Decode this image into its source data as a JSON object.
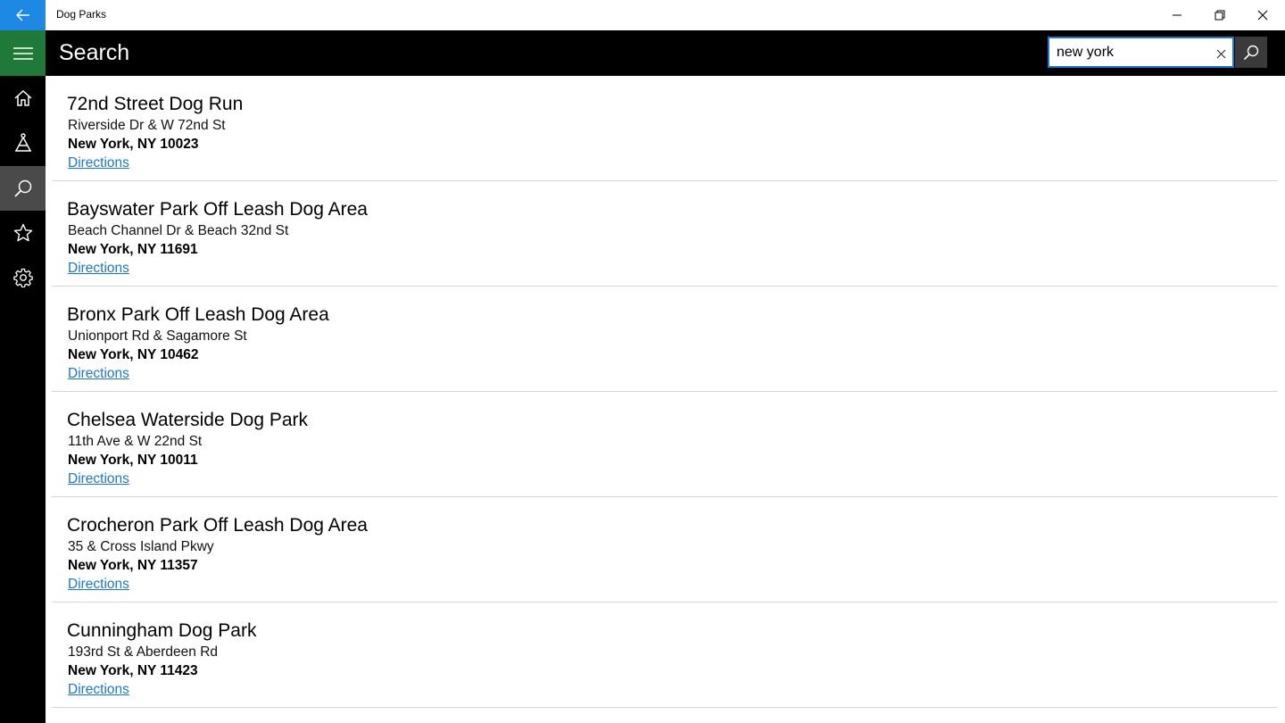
{
  "window": {
    "title": "Dog Parks",
    "accent": "#1e88e5"
  },
  "header": {
    "title": "Search",
    "search": {
      "value": "new york",
      "placeholder": ""
    }
  },
  "sidebar": {
    "items": [
      {
        "icon": "home-icon",
        "label": "Home"
      },
      {
        "icon": "park-icon",
        "label": "Parks"
      },
      {
        "icon": "search-icon",
        "label": "Search",
        "active": true
      },
      {
        "icon": "star-icon",
        "label": "Favorites"
      },
      {
        "icon": "gear-icon",
        "label": "Settings"
      }
    ]
  },
  "results": [
    {
      "name": "72nd Street Dog Run",
      "address": "Riverside Dr & W 72nd St",
      "city": "New York, NY 10023",
      "link": "Directions"
    },
    {
      "name": "Bayswater Park Off Leash Dog Area",
      "address": "Beach Channel Dr & Beach 32nd St",
      "city": "New York, NY 11691",
      "link": "Directions"
    },
    {
      "name": "Bronx Park Off Leash Dog Area",
      "address": "Unionport Rd & Sagamore St",
      "city": "New York, NY 10462",
      "link": "Directions"
    },
    {
      "name": "Chelsea Waterside Dog Park",
      "address": "11th Ave & W 22nd St",
      "city": "New York, NY 10011",
      "link": "Directions"
    },
    {
      "name": "Crocheron Park Off Leash Dog Area",
      "address": "35 & Cross Island Pkwy",
      "city": "New York, NY 11357",
      "link": "Directions"
    },
    {
      "name": "Cunningham Dog Park",
      "address": "193rd St & Aberdeen Rd",
      "city": "New York, NY 11423",
      "link": "Directions"
    }
  ]
}
